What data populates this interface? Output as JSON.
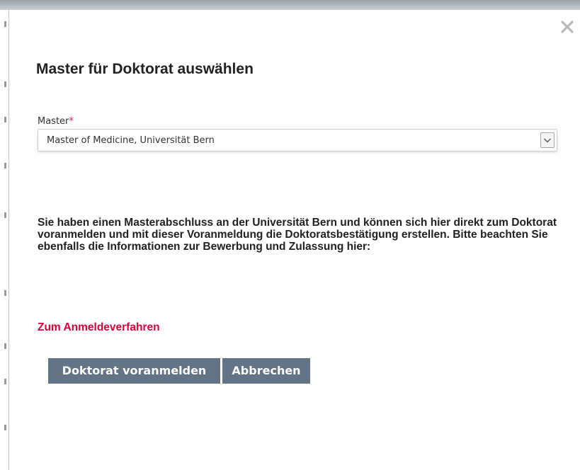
{
  "dialog": {
    "title": "Master für Doktorat auswählen",
    "close_icon": "close-icon"
  },
  "master_field": {
    "label": "Master",
    "required_marker": "*",
    "selected_value": "Master of Medicine, Universität Bern",
    "dropdown_icon": "chevron-down-icon"
  },
  "info_text": "Sie haben einen Masterabschluss an der Universität Bern und können sich hier direkt zum Doktorat voranmelden und mit dieser Voranmeldung die Doktoratsbestätigung erstellen. Bitte beachten Sie ebenfalls die Informationen zur Bewerbung und Zulassung hier:",
  "link": {
    "label": "Zum Anmeldeverfahren"
  },
  "buttons": {
    "submit_label": "Doktorat voranmelden",
    "cancel_label": "Abbrechen"
  },
  "colors": {
    "button_bg": "#637486",
    "link": "#d6003a",
    "required": "#e2314f"
  }
}
